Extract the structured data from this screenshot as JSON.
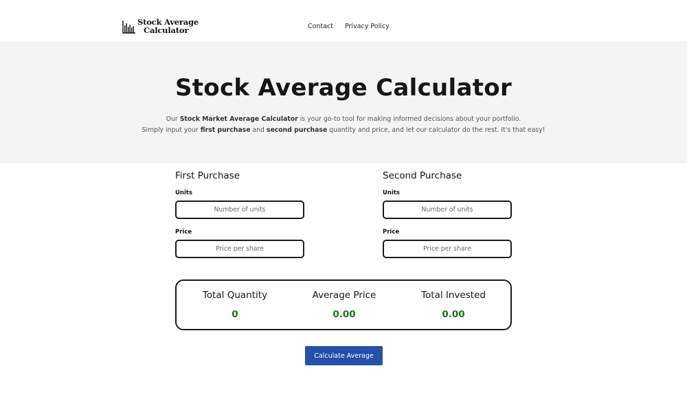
{
  "header": {
    "logo_line1": "Stock Average",
    "logo_line2": "Calculator",
    "nav": [
      {
        "label": "Contact"
      },
      {
        "label": "Privacy Policy"
      }
    ]
  },
  "hero": {
    "title": "Stock Average Calculator",
    "line1": {
      "t1": "Our ",
      "b1": "Stock Market Average Calculator",
      "t2": " is your go-to tool for making informed decisions about your portfolio."
    },
    "line2": {
      "t1": "Simply input your ",
      "b1": "first purchase",
      "t2": " and ",
      "b2": "second purchase",
      "t3": " quantity and price, and let our calculator do the rest. It's that easy!"
    }
  },
  "first_purchase": {
    "title": "First Purchase",
    "units_label": "Units",
    "units_value": "",
    "units_placeholder": "Number of units",
    "price_label": "Price",
    "price_value": "",
    "price_placeholder": "Price per share"
  },
  "second_purchase": {
    "title": "Second Purchase",
    "units_label": "Units",
    "units_value": "",
    "units_placeholder": "Number of units",
    "price_label": "Price",
    "price_value": "",
    "price_placeholder": "Price per share"
  },
  "results": {
    "total_quantity_label": "Total Quantity",
    "total_quantity_value": "0",
    "average_price_label": "Average Price",
    "average_price_value": "0.00",
    "total_invested_label": "Total Invested",
    "total_invested_value": "0.00"
  },
  "button": {
    "calculate_label": "Calculate Average"
  },
  "colors": {
    "hero_bg": "#f4f4f4",
    "result_value": "#1f6e1f",
    "button_bg": "#2350a8"
  },
  "icons": {
    "logo": "bar-chart-icon"
  }
}
